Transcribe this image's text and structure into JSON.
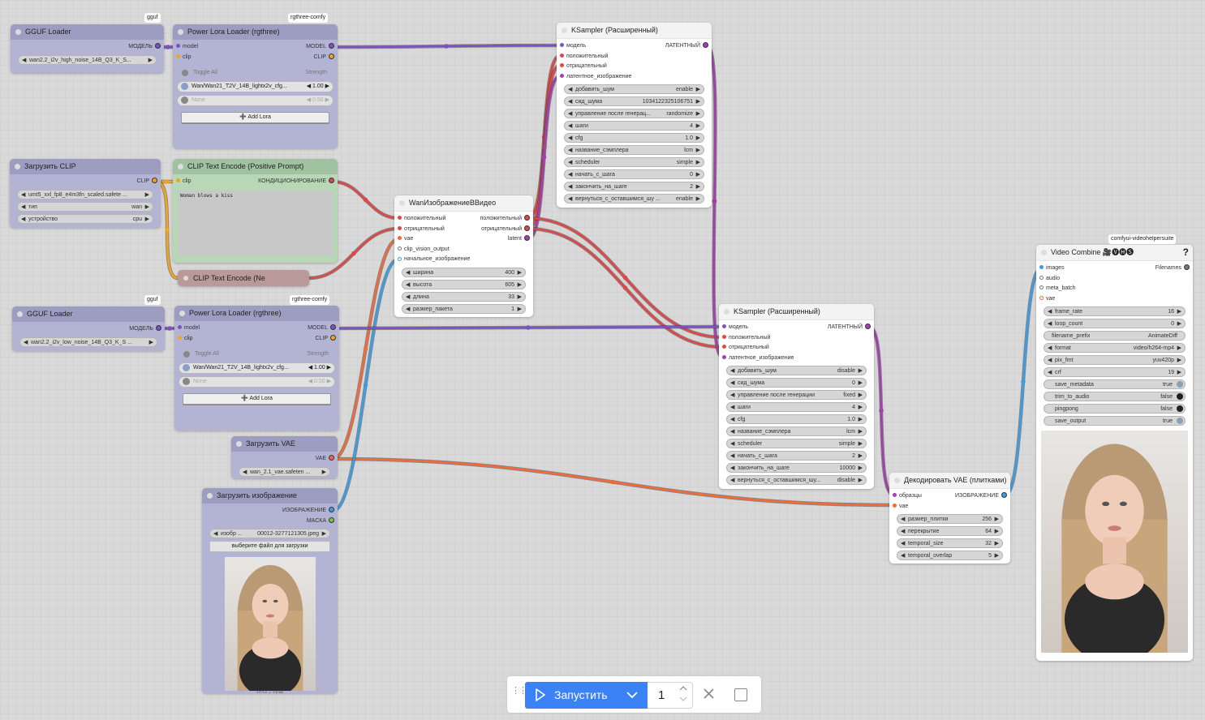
{
  "colors": {
    "model": "#7b52c4",
    "clip": "#f2a51c",
    "conditioning": "#e04848",
    "latent": "#a33fb0",
    "vae": "#f06a3a",
    "image": "#3a9ee6",
    "mask": "#7fc24a",
    "other": "#777777",
    "accent": "#3b82f6"
  },
  "nodes": [
    {
      "id": "gguf_high",
      "title": "GGUF Loader",
      "badge": "gguf",
      "theme": "lav",
      "inputs": [],
      "outputs": [
        {
          "label": "МОДЕЛЬ",
          "type": "model"
        }
      ],
      "widgets": [
        {
          "type": "combo",
          "label": "wan2.2_i2v_high_noise_14B_Q3_K_S...",
          "value": ""
        }
      ]
    },
    {
      "id": "lora_high",
      "title": "Power Lora Loader (rgthree)",
      "badge": "rgthree-comfy",
      "theme": "lav",
      "inputs": [
        {
          "label": "model",
          "type": "model"
        },
        {
          "label": "clip",
          "type": "clip"
        }
      ],
      "outputs": [
        {
          "label": "MODEL",
          "type": "model"
        },
        {
          "label": "CLIP",
          "type": "clip"
        }
      ],
      "widgets": [
        {
          "type": "toggle-header",
          "label": "Toggle All",
          "value": "Strength"
        },
        {
          "type": "lora",
          "label": "Wan/Wan21_T2V_14B_lightx2v_cfg...",
          "value": "1.00",
          "enabled": true
        },
        {
          "type": "lora",
          "label": "None",
          "value": "0.50",
          "enabled": false
        },
        {
          "type": "button",
          "label": "Add Lora",
          "icon": "plus-icon"
        }
      ]
    },
    {
      "id": "clip_loader",
      "title": "Загрузить CLIP",
      "theme": "lav",
      "inputs": [],
      "outputs": [
        {
          "label": "CLIP",
          "type": "clip"
        }
      ],
      "widgets": [
        {
          "type": "combo",
          "label": "umt5_xxl_fp8_e4m3fn_scaled.safete ...",
          "value": ""
        },
        {
          "type": "combo",
          "label": "тип",
          "value": "wan"
        },
        {
          "type": "combo",
          "label": "устройство",
          "value": "cpu"
        }
      ]
    },
    {
      "id": "clip_pos",
      "title": "CLIP Text Encode (Positive Prompt)",
      "theme": "green",
      "inputs": [
        {
          "label": "clip",
          "type": "clip"
        }
      ],
      "outputs": [
        {
          "label": "КОНДИЦИОНИРОВАНИЕ",
          "type": "conditioning"
        }
      ],
      "widgets": [
        {
          "type": "textarea",
          "value": "Woman blows a kiss"
        }
      ]
    },
    {
      "id": "clip_neg",
      "title": "CLIP Text Encode (Ne",
      "theme": "neg",
      "collapsed": true,
      "inputs": [],
      "outputs": [],
      "widgets": []
    },
    {
      "id": "gguf_low",
      "title": "GGUF Loader",
      "badge": "gguf",
      "theme": "lav",
      "inputs": [],
      "outputs": [
        {
          "label": "МОДЕЛЬ",
          "type": "model"
        }
      ],
      "widgets": [
        {
          "type": "combo",
          "label": "wan2.2_i2v_low_noise_14B_Q3_K_S ...",
          "value": ""
        }
      ]
    },
    {
      "id": "lora_low",
      "title": "Power Lora Loader (rgthree)",
      "badge": "rgthree-comfy",
      "theme": "lav",
      "inputs": [
        {
          "label": "model",
          "type": "model"
        },
        {
          "label": "clip",
          "type": "clip"
        }
      ],
      "outputs": [
        {
          "label": "MODEL",
          "type": "model"
        },
        {
          "label": "CLIP",
          "type": "clip"
        }
      ],
      "widgets": [
        {
          "type": "toggle-header",
          "label": "Toggle All",
          "value": "Strength"
        },
        {
          "type": "lora",
          "label": "Wan/Wan21_T2V_14B_lightx2v_cfg...",
          "value": "1.00",
          "enabled": true
        },
        {
          "type": "lora",
          "label": "None",
          "value": "0.50",
          "enabled": false
        },
        {
          "type": "button",
          "label": "Add Lora",
          "icon": "plus-icon"
        }
      ]
    },
    {
      "id": "vae_loader",
      "title": "Загрузить VAE",
      "theme": "lav",
      "inputs": [],
      "outputs": [
        {
          "label": "VAE",
          "type": "vae"
        }
      ],
      "widgets": [
        {
          "type": "combo",
          "label": "wan_2.1_vae.safeten ...",
          "value": ""
        }
      ]
    },
    {
      "id": "load_image",
      "title": "Загрузить изображение",
      "theme": "lav",
      "inputs": [],
      "outputs": [
        {
          "label": "ИЗОБРАЖЕНИЕ",
          "type": "image"
        },
        {
          "label": "МАСКА",
          "type": "mask"
        }
      ],
      "widgets": [
        {
          "type": "combo",
          "label": "изобр ...",
          "value": "00012-3277121305.jpeg"
        },
        {
          "type": "upload",
          "label": "выберите файл для загрузки"
        },
        {
          "type": "image",
          "caption": "1024 × 1536"
        }
      ]
    },
    {
      "id": "wan_i2v",
      "title": "WanИзображениеВВидео",
      "theme": "white",
      "inputs": [
        {
          "label": "положительный",
          "type": "conditioning"
        },
        {
          "label": "отрицательный",
          "type": "conditioning"
        },
        {
          "label": "vae",
          "type": "vae"
        },
        {
          "label": "clip_vision_output",
          "type": "other",
          "hollow": true
        },
        {
          "label": "начальное_изображение",
          "type": "image",
          "hollow": true
        }
      ],
      "outputs": [
        {
          "label": "положительный",
          "type": "conditioning"
        },
        {
          "label": "отрицательный",
          "type": "conditioning"
        },
        {
          "label": "latent",
          "type": "latent"
        }
      ],
      "widgets": [
        {
          "type": "combo",
          "label": "ширина",
          "value": "400"
        },
        {
          "type": "combo",
          "label": "высота",
          "value": "605"
        },
        {
          "type": "combo",
          "label": "длина",
          "value": "33"
        },
        {
          "type": "combo",
          "label": "размер_пакета",
          "value": "1"
        }
      ]
    },
    {
      "id": "ksampler1",
      "title": "KSampler (Расширенный)",
      "theme": "white",
      "inputs": [
        {
          "label": "модель",
          "type": "model"
        },
        {
          "label": "положительный",
          "type": "conditioning"
        },
        {
          "label": "отрицательный",
          "type": "conditioning"
        },
        {
          "label": "латентное_изображение",
          "type": "latent"
        }
      ],
      "outputs": [
        {
          "label": "ЛАТЕНТНЫЙ",
          "type": "latent"
        }
      ],
      "widgets": [
        {
          "type": "combo",
          "label": "добавить_шум",
          "value": "enable"
        },
        {
          "type": "combo",
          "label": "сид_шума",
          "value": "1034122325106751"
        },
        {
          "type": "combo",
          "label": "управление после генерац...",
          "value": "randomize"
        },
        {
          "type": "combo",
          "label": "шаги",
          "value": "4"
        },
        {
          "type": "combo",
          "label": "cfg",
          "value": "1.0"
        },
        {
          "type": "combo",
          "label": "название_сэмплера",
          "value": "lcm"
        },
        {
          "type": "combo",
          "label": "scheduler",
          "value": "simple"
        },
        {
          "type": "combo",
          "label": "начать_с_шага",
          "value": "0"
        },
        {
          "type": "combo",
          "label": "закончить_на_шаге",
          "value": "2"
        },
        {
          "type": "combo",
          "label": "вернуться_с_оставшимся_шу ...",
          "value": "enable"
        }
      ]
    },
    {
      "id": "ksampler2",
      "title": "KSampler (Расширенный)",
      "theme": "white",
      "inputs": [
        {
          "label": "модель",
          "type": "model"
        },
        {
          "label": "положительный",
          "type": "conditioning"
        },
        {
          "label": "отрицательный",
          "type": "conditioning"
        },
        {
          "label": "латентное_изображение",
          "type": "latent"
        }
      ],
      "outputs": [
        {
          "label": "ЛАТЕНТНЫЙ",
          "type": "latent"
        }
      ],
      "widgets": [
        {
          "type": "combo",
          "label": "добавить_шум",
          "value": "disable"
        },
        {
          "type": "combo",
          "label": "сид_шума",
          "value": "0"
        },
        {
          "type": "combo",
          "label": "управление после генерации",
          "value": "fixed"
        },
        {
          "type": "combo",
          "label": "шаги",
          "value": "4"
        },
        {
          "type": "combo",
          "label": "cfg",
          "value": "1.0"
        },
        {
          "type": "combo",
          "label": "название_сэмплера",
          "value": "lcm"
        },
        {
          "type": "combo",
          "label": "scheduler",
          "value": "simple"
        },
        {
          "type": "combo",
          "label": "начать_с_шага",
          "value": "2"
        },
        {
          "type": "combo",
          "label": "закончить_на_шаге",
          "value": "10000"
        },
        {
          "type": "combo",
          "label": "вернуться_с_оставшимся_шу...",
          "value": "disable"
        }
      ]
    },
    {
      "id": "vae_decode",
      "title": "Декодировать VAE (плитками)",
      "theme": "white",
      "inputs": [
        {
          "label": "образцы",
          "type": "latent"
        },
        {
          "label": "vae",
          "type": "vae"
        }
      ],
      "outputs": [
        {
          "label": "ИЗОБРАЖЕНИЕ",
          "type": "image"
        }
      ],
      "widgets": [
        {
          "type": "combo",
          "label": "размер_плитки",
          "value": "256"
        },
        {
          "type": "combo",
          "label": "перекрытие",
          "value": "64"
        },
        {
          "type": "combo",
          "label": "temporal_size",
          "value": "32"
        },
        {
          "type": "combo",
          "label": "temporal_overlap",
          "value": "5"
        }
      ]
    },
    {
      "id": "video_combine",
      "title": "Video Combine 🎥🅥🅗🅢",
      "badge": "comfyui-videohelpersuite",
      "help": "?",
      "theme": "white",
      "inputs": [
        {
          "label": "images",
          "type": "image"
        },
        {
          "label": "audio",
          "type": "other",
          "hollow": true
        },
        {
          "label": "meta_batch",
          "type": "other",
          "hollow": true
        },
        {
          "label": "vae",
          "type": "vae",
          "hollow": true
        }
      ],
      "outputs": [
        {
          "label": "Filenames",
          "type": "other"
        }
      ],
      "widgets": [
        {
          "type": "combo",
          "label": "frame_rate",
          "value": "16"
        },
        {
          "type": "combo",
          "label": "loop_count",
          "value": "0"
        },
        {
          "type": "text",
          "label": "filename_prefix",
          "value": "AnimateDiff"
        },
        {
          "type": "combo",
          "label": "format",
          "value": "video/h264-mp4"
        },
        {
          "type": "combo",
          "label": "pix_fmt",
          "value": "yuv420p"
        },
        {
          "type": "combo",
          "label": "crf",
          "value": "19"
        },
        {
          "type": "bool",
          "label": "save_metadata",
          "value": "true",
          "on": true
        },
        {
          "type": "bool",
          "label": "trim_to_audio",
          "value": "false",
          "on": false
        },
        {
          "type": "bool",
          "label": "pingpong",
          "value": "false",
          "on": false
        },
        {
          "type": "bool",
          "label": "save_output",
          "value": "true",
          "on": true
        },
        {
          "type": "image",
          "caption": ""
        }
      ]
    }
  ],
  "toolbar": {
    "run_label": "Запустить",
    "run_icon": "play-icon",
    "queue_count": "1",
    "cancel_icon": "close-icon",
    "stop_icon": "square-icon",
    "grip_icon": "drag-handle-icon"
  }
}
